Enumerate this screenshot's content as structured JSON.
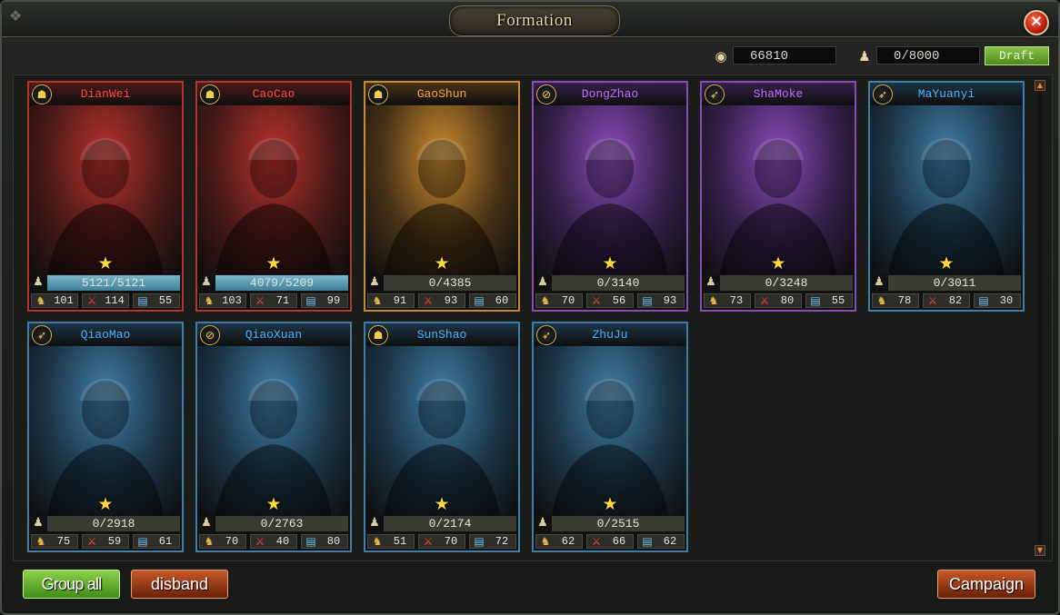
{
  "window": {
    "title": "Formation",
    "close_label": "✕"
  },
  "resources": {
    "gold": "66810",
    "troops": "0/8000",
    "draft_label": "Draft"
  },
  "heroes": [
    {
      "name": "DianWei",
      "troops": "5121/5121",
      "full": true,
      "lead": "101",
      "war": "114",
      "int": "55",
      "class_icon": "helmet-icon",
      "frame": "#b8322e",
      "name_color": "#ff4b3d",
      "bg": "#4a1a18"
    },
    {
      "name": "CaoCao",
      "troops": "4079/5209",
      "full": true,
      "lead": "103",
      "war": "71",
      "int": "99",
      "class_icon": "helmet-icon",
      "frame": "#b8322e",
      "name_color": "#ff4b3d",
      "bg": "#4a1a18"
    },
    {
      "name": "GaoShun",
      "troops": "0/4385",
      "full": false,
      "lead": "91",
      "war": "93",
      "int": "60",
      "class_icon": "helmet-icon",
      "frame": "#c98a2e",
      "name_color": "#ffa63a",
      "bg": "#4a3317"
    },
    {
      "name": "DongZhao",
      "troops": "0/3140",
      "full": false,
      "lead": "70",
      "war": "56",
      "int": "93",
      "class_icon": "bow-icon",
      "frame": "#8a4bb8",
      "name_color": "#c46cff",
      "bg": "#35204a"
    },
    {
      "name": "ShaMoke",
      "troops": "0/3248",
      "full": false,
      "lead": "73",
      "war": "80",
      "int": "55",
      "class_icon": "spear-icon",
      "frame": "#8a4bb8",
      "name_color": "#c46cff",
      "bg": "#35204a"
    },
    {
      "name": "MaYuanyi",
      "troops": "0/3011",
      "full": false,
      "lead": "78",
      "war": "82",
      "int": "30",
      "class_icon": "spear-icon",
      "frame": "#3f7ea8",
      "name_color": "#4db2ff",
      "bg": "#1c3445"
    },
    {
      "name": "QiaoMao",
      "troops": "0/2918",
      "full": false,
      "lead": "75",
      "war": "59",
      "int": "61",
      "class_icon": "spear-icon",
      "frame": "#3f7ea8",
      "name_color": "#4db2ff",
      "bg": "#1c3445"
    },
    {
      "name": "QiaoXuan",
      "troops": "0/2763",
      "full": false,
      "lead": "70",
      "war": "40",
      "int": "80",
      "class_icon": "bow-icon",
      "frame": "#3f7ea8",
      "name_color": "#4db2ff",
      "bg": "#1c3445"
    },
    {
      "name": "SunShao",
      "troops": "0/2174",
      "full": false,
      "lead": "51",
      "war": "70",
      "int": "72",
      "class_icon": "helmet-icon",
      "frame": "#3f7ea8",
      "name_color": "#4db2ff",
      "bg": "#1c3445"
    },
    {
      "name": "ZhuJu",
      "troops": "0/2515",
      "full": false,
      "lead": "62",
      "war": "66",
      "int": "62",
      "class_icon": "spear-icon",
      "frame": "#3f7ea8",
      "name_color": "#4db2ff",
      "bg": "#1c3445"
    }
  ],
  "buttons": {
    "group_all": "Group all",
    "disband": "disband",
    "campaign": "Campaign"
  }
}
